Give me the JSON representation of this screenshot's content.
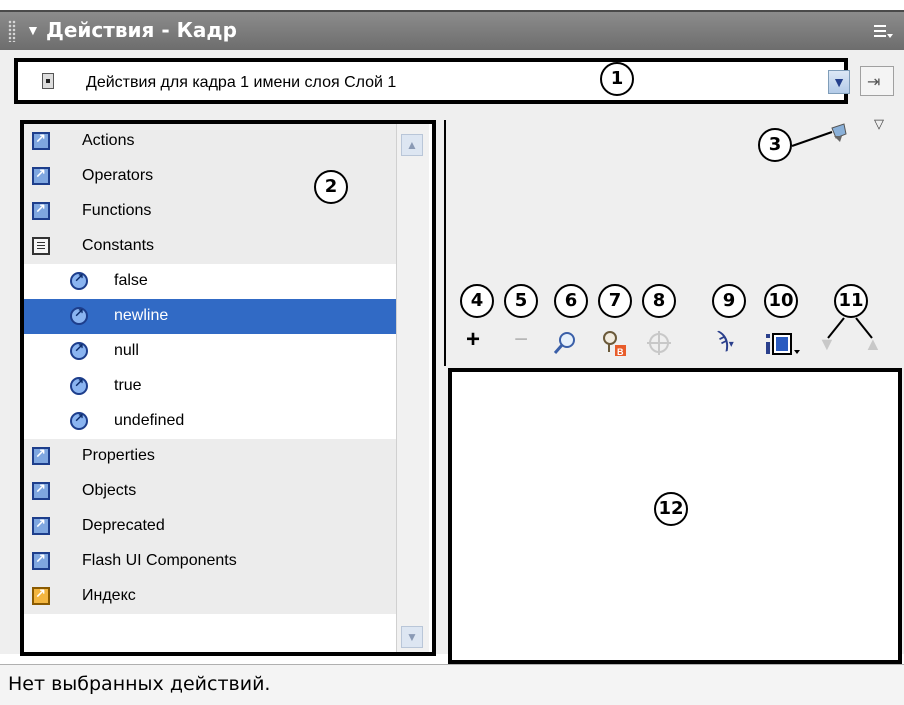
{
  "panel": {
    "title": "Действия - Кадр",
    "icons": {
      "collapse": "triangle-down-icon",
      "grip": "grip-icon",
      "menu": "panel-options-icon"
    }
  },
  "toolbar": {
    "target_text": "Действия для кадра 1 имени слоя Слой 1",
    "target_icon": "frame-icon",
    "dropdown_icon": "chevron-down-icon",
    "pin_icon": "pin-script-icon",
    "view_options_icon": "triangle-down-icon"
  },
  "tree": {
    "categories": [
      {
        "label": "Actions",
        "icon": "book-icon"
      },
      {
        "label": "Operators",
        "icon": "book-icon"
      },
      {
        "label": "Functions",
        "icon": "book-icon"
      },
      {
        "label": "Constants",
        "icon": "open-book-icon"
      }
    ],
    "constants": [
      {
        "label": "false",
        "selected": false
      },
      {
        "label": "newline",
        "selected": true
      },
      {
        "label": "null",
        "selected": false
      },
      {
        "label": "true",
        "selected": false
      },
      {
        "label": "undefined",
        "selected": false
      }
    ],
    "categories_after": [
      {
        "label": "Properties",
        "icon": "book-icon"
      },
      {
        "label": "Objects",
        "icon": "book-icon"
      },
      {
        "label": "Deprecated",
        "icon": "book-icon"
      },
      {
        "label": "Flash UI Components",
        "icon": "book-icon"
      },
      {
        "label": "Индекс",
        "icon": "index-book-icon"
      }
    ]
  },
  "script_tools": [
    {
      "name": "add-statement-icon",
      "glyph": "+"
    },
    {
      "name": "delete-statement-icon",
      "glyph": "−"
    },
    {
      "name": "find-icon",
      "glyph": "⌕"
    },
    {
      "name": "replace-icon",
      "glyph": "⚲"
    },
    {
      "name": "insert-target-path-icon",
      "glyph": "⊕"
    },
    {
      "name": "debug-options-icon",
      "glyph": "↝"
    },
    {
      "name": "view-options-icon",
      "glyph": "▣"
    },
    {
      "name": "move-down-icon",
      "glyph": "▼"
    },
    {
      "name": "move-up-icon",
      "glyph": "▲"
    }
  ],
  "callouts": [
    "1",
    "2",
    "3",
    "4",
    "5",
    "6",
    "7",
    "8",
    "9",
    "10",
    "11",
    "12"
  ],
  "status": {
    "text": "Нет выбранных действий."
  },
  "colors": {
    "selection": "#316ac5",
    "titlebar": "#7a7a7a",
    "annotation": "#000000"
  }
}
